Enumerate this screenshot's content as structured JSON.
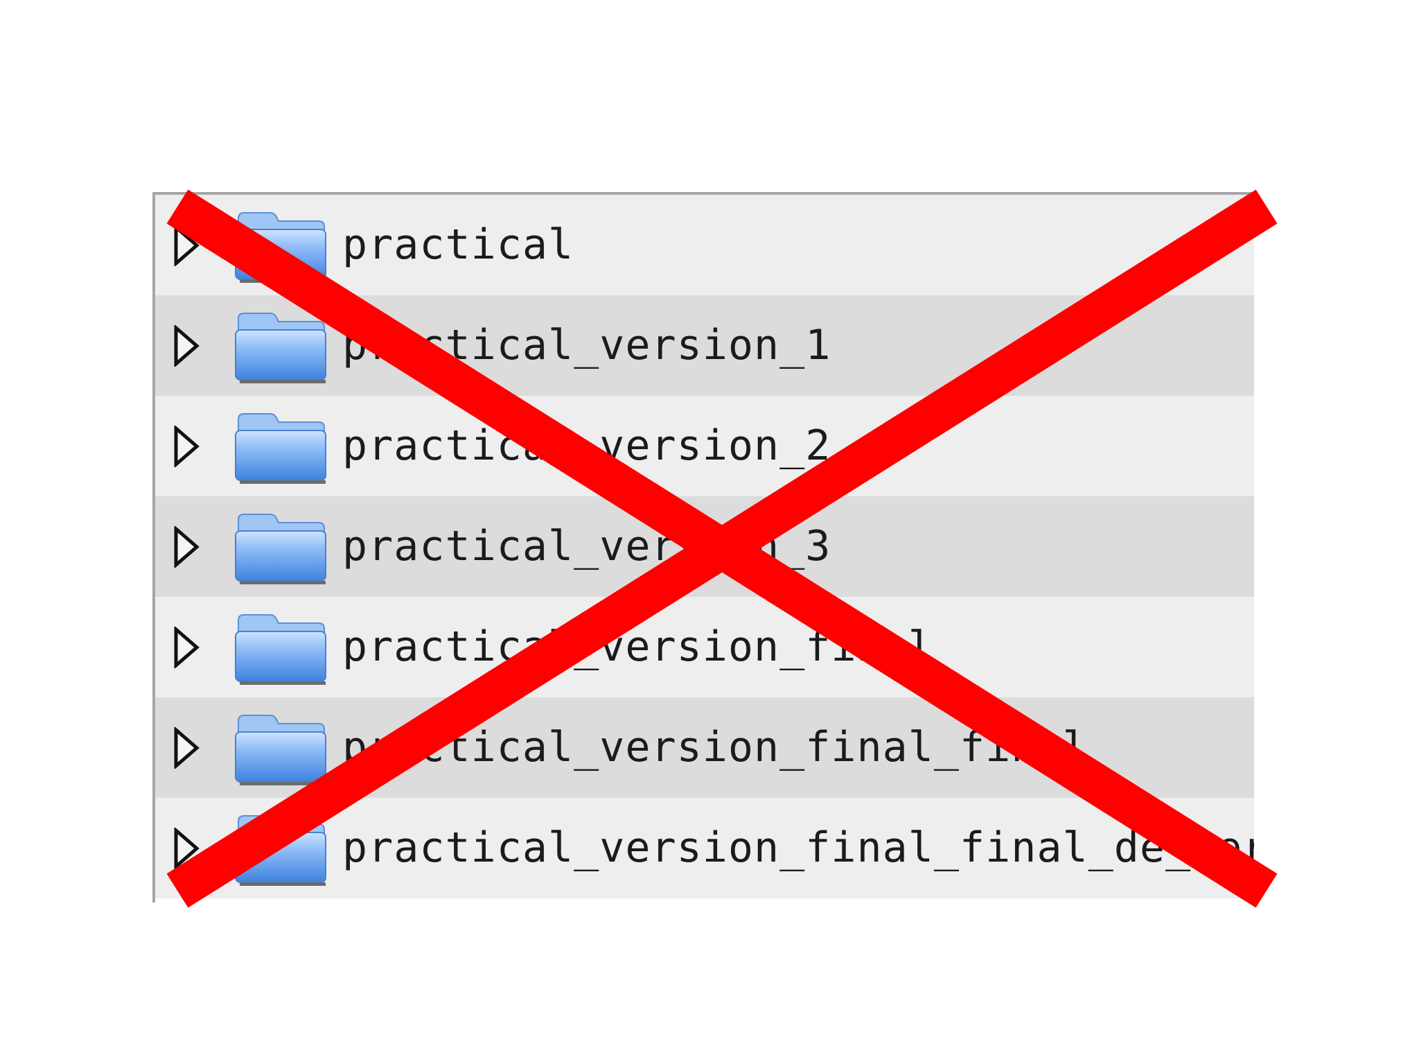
{
  "file_tree": {
    "rows": [
      {
        "label": "practical"
      },
      {
        "label": "practical_version_1"
      },
      {
        "label": "practical_version_2"
      },
      {
        "label": "practical_version_3"
      },
      {
        "label": "practical_version_final"
      },
      {
        "label": "practical_version_final_final"
      },
      {
        "label": "practical_version_final_final_de_verdad"
      }
    ],
    "row_colors": [
      "#eeeeee",
      "#dcdcdd"
    ],
    "folder_color": "#6ea6ee",
    "expander_icon": "triangle-right-outline-icon",
    "folder_icon": "blue-folder-icon"
  },
  "overlay": {
    "icon": "red-x-cross-icon",
    "color": "#ff0000"
  }
}
